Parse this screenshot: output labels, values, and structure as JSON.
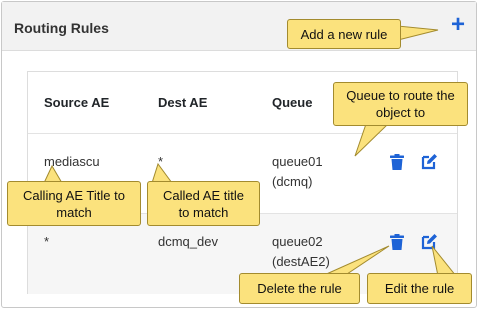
{
  "header": {
    "title": "Routing Rules",
    "add_icon": "plus-icon"
  },
  "table": {
    "columns": [
      "Source AE",
      "Dest AE",
      "Queue"
    ],
    "rows": [
      {
        "source": "mediascu",
        "dest": "*",
        "queue_name": "queue01",
        "queue_ae": "(dcmq)"
      },
      {
        "source": "*",
        "dest": "dcmq_dev",
        "queue_name": "queue02",
        "queue_ae": "(destAE2)"
      }
    ],
    "delete_icon": "trash-icon",
    "edit_icon": "edit-icon"
  },
  "callouts": {
    "add": "Add a new rule",
    "queue_line1": "Queue to route the",
    "queue_line2": "object to",
    "calling_line1": "Calling AE Title to",
    "calling_line2": "match",
    "called_line1": "Called AE title",
    "called_line2": "to match",
    "delete": "Delete the rule",
    "edit": "Edit the rule"
  },
  "colors": {
    "accent": "#1e63d6",
    "callout_fill": "#fbe27d",
    "callout_border": "#a38b2e"
  }
}
